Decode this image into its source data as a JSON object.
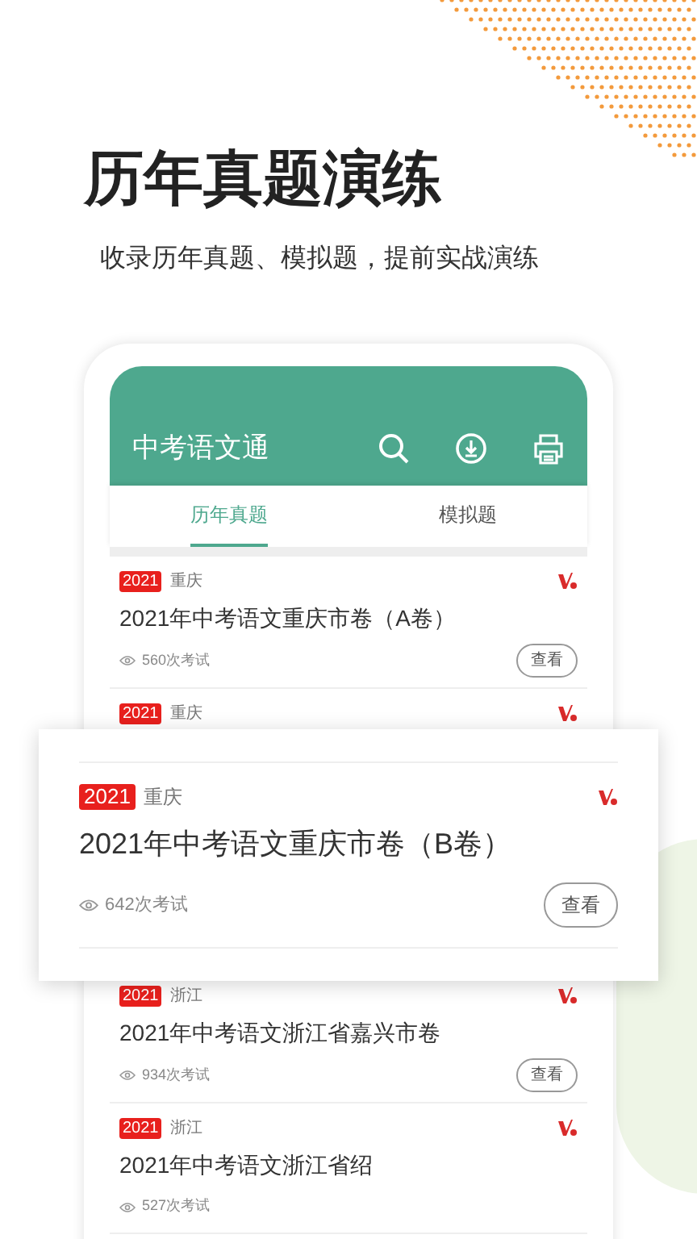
{
  "headline": "历年真题演练",
  "subtitle": "收录历年真题、模拟题，提前实战演练",
  "app": {
    "title": "中考语文通",
    "tabs": [
      {
        "label": "历年真题",
        "selected": true
      },
      {
        "label": "模拟题",
        "selected": false
      }
    ],
    "items": [
      {
        "kind": "full",
        "year": "2021",
        "region": "重庆",
        "title": "2021年中考语文重庆市卷（A卷）",
        "views": "560次考试",
        "button": "查看"
      },
      {
        "kind": "header",
        "year": "2021",
        "region": "重庆"
      },
      {
        "kind": "featured",
        "year": "2021",
        "region": "重庆",
        "title": "2021年中考语文重庆市卷（B卷）",
        "views": "642次考试",
        "button": "查看"
      },
      {
        "kind": "full",
        "year": "2021",
        "region": "浙江",
        "title": "2021年中考语文浙江省嘉兴市卷",
        "views": "934次考试",
        "button": "查看"
      },
      {
        "kind": "full",
        "year": "2021",
        "region": "浙江",
        "title": "2021年中考语文浙江省绍",
        "views": "527次考试"
      }
    ]
  }
}
